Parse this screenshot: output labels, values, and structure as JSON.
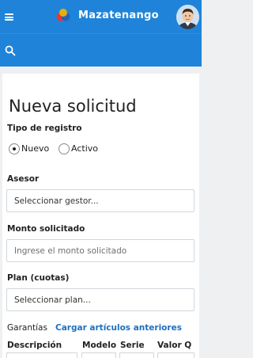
{
  "header": {
    "app_title": "Mazatenango",
    "menu_icon": "hamburger-menu-icon",
    "logo_icon": "tricolor-dots-logo",
    "avatar_icon": "user-avatar",
    "bar_color": "#1f84d9"
  },
  "search": {
    "icon": "search-icon"
  },
  "form": {
    "title": "Nueva solicitud",
    "tipo_registro": {
      "label": "Tipo de registro",
      "options": [
        {
          "label": "Nuevo",
          "selected": true
        },
        {
          "label": "Activo",
          "selected": false
        }
      ]
    },
    "asesor": {
      "label": "Asesor",
      "value": "Seleccionar gestor..."
    },
    "monto": {
      "label": "Monto solicitado",
      "placeholder": "Ingrese el monto solicitado"
    },
    "plan": {
      "label": "Plan (cuotas)",
      "value": "Seleccionar plan..."
    },
    "garantias": {
      "label": "Garantías",
      "link": "Cargar artículos anteriores",
      "link_color": "#1f6fc0",
      "columns": [
        "Descripción",
        "Modelo",
        "Serie",
        "Valor Q"
      ]
    }
  }
}
